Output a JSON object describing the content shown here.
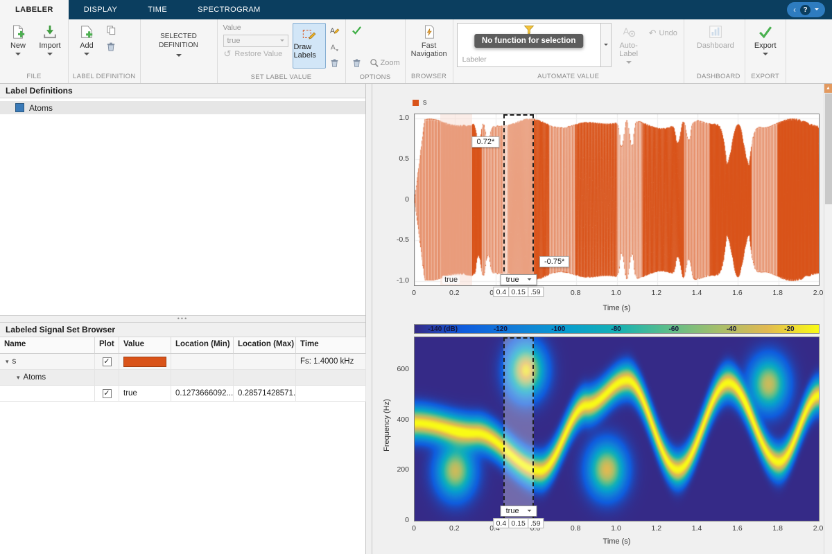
{
  "colors": {
    "accent_orange": "#D95319",
    "toolstrip_blue": "#0B3E5F",
    "help_pill_blue": "#2E7CC0",
    "selected_button_bg": "#D2E6F7",
    "colormap": "parula"
  },
  "tabbar": {
    "tabs": [
      {
        "label": "LABELER",
        "active": true
      },
      {
        "label": "DISPLAY",
        "active": false
      },
      {
        "label": "TIME",
        "active": false
      },
      {
        "label": "SPECTROGRAM",
        "active": false
      }
    ]
  },
  "ribbon": {
    "file": {
      "section": "FILE",
      "new": "New",
      "import": "Import"
    },
    "label_definition": {
      "section": "LABEL DEFINITION",
      "add": "Add"
    },
    "selected_definition": {
      "button": "SELECTED DEFINITION"
    },
    "set_label_value": {
      "section": "SET LABEL VALUE",
      "value_caption": "Value",
      "value": "true",
      "restore": "Restore Value",
      "draw_labels": "Draw Labels"
    },
    "options": {
      "section": "OPTIONS",
      "zoom": "Zoom"
    },
    "browser": {
      "section": "BROWSER",
      "fast_navigation": "Fast Navigation"
    },
    "automate": {
      "section": "AUTOMATE VALUE",
      "tooltip": "No function for selection",
      "gallery_caption": "Labeler",
      "auto_label": "Auto-Label",
      "undo": "Undo"
    },
    "dashboard": {
      "section": "DASHBOARD",
      "button": "Dashboard"
    },
    "export": {
      "section": "EXPORT",
      "button": "Export"
    }
  },
  "panels": {
    "label_definitions": {
      "title": "Label Definitions",
      "items": [
        {
          "name": "Atoms",
          "selected": true
        }
      ]
    },
    "signal_browser": {
      "title": "Labeled Signal Set Browser",
      "columns": [
        "Name",
        "Plot",
        "Value",
        "Location (Min)",
        "Location (Max)",
        "Time"
      ],
      "rows": [
        {
          "name": "s",
          "expanded": true,
          "plot_checked": true,
          "value": "",
          "has_swatch": true,
          "loc_min": "",
          "loc_max": "",
          "time": "Fs: 1.4000 kHz"
        },
        {
          "name": "Atoms",
          "expanded": true,
          "plot_checked": false,
          "value": "",
          "has_swatch": false,
          "loc_min": "",
          "loc_max": "",
          "time": ""
        },
        {
          "name": "",
          "expanded": false,
          "plot_checked": true,
          "value": "true",
          "has_swatch": false,
          "loc_min": "0.1273666092...",
          "loc_max": "0.28571428571...",
          "time": ""
        }
      ]
    }
  },
  "chart_data": [
    {
      "type": "line",
      "legend_label": "s",
      "series_color": "#D95319",
      "xlabel": "Time (s)",
      "ylabel": "",
      "xlim": [
        0,
        2
      ],
      "ylim": [
        -1.05,
        1.05
      ],
      "xticks": [
        0,
        0.2,
        0.4,
        0.6,
        0.8,
        1.0,
        1.2,
        1.4,
        1.6,
        1.8,
        2.0
      ],
      "yticks": [
        1.0,
        0.5,
        0,
        -0.5,
        -1.0
      ],
      "description": "Dense oscillatory signal s(t) filling amplitude range -1..1 over 0..2 s, with envelope pinches near t=0.34, 1.05, 1.33 and 1.6 s",
      "labeled_region": {
        "start": 0.1273666092,
        "end": 0.28571428571,
        "label": "true"
      },
      "selection": {
        "start": 0.44,
        "end": 0.59,
        "dropdown": "true",
        "value_boxes": [
          "0.4",
          "0.15",
          ".59"
        ],
        "tooltip_high": "0.72*",
        "tooltip_low": "-0.75*"
      }
    },
    {
      "type": "heatmap",
      "xlabel": "Time (s)",
      "ylabel": "Frequency (Hz)",
      "xlim": [
        0,
        2
      ],
      "ylim": [
        0,
        730
      ],
      "xticks": [
        0,
        0.2,
        0.4,
        0.6,
        0.8,
        1.0,
        1.2,
        1.4,
        1.6,
        1.8,
        2.0
      ],
      "yticks": [
        0,
        200,
        400,
        600
      ],
      "colorbar": {
        "range_db": [
          -150,
          -10
        ],
        "ticks": [
          {
            "value": -140,
            "label": "-140 (dB)"
          },
          {
            "value": -120,
            "label": "-120"
          },
          {
            "value": -100,
            "label": "-100"
          },
          {
            "value": -80,
            "label": "-80"
          },
          {
            "value": -60,
            "label": "-60"
          },
          {
            "value": -40,
            "label": "-40"
          },
          {
            "value": -20,
            "label": "-20"
          }
        ]
      },
      "ridge_track_hz": [
        [
          0,
          390
        ],
        [
          0.3,
          350
        ],
        [
          0.62,
          200
        ],
        [
          0.85,
          460
        ],
        [
          1.05,
          560
        ],
        [
          1.3,
          205
        ],
        [
          1.55,
          550
        ],
        [
          1.8,
          235
        ],
        [
          2.0,
          500
        ]
      ],
      "blobs": [
        {
          "t": 0.2,
          "f": 200,
          "a": 0.8
        },
        {
          "t": 0.55,
          "f": 600,
          "a": 0.95
        },
        {
          "t": 0.95,
          "f": 205,
          "a": 0.85
        },
        {
          "t": 1.75,
          "f": 545,
          "a": 0.8
        }
      ],
      "selection": {
        "start": 0.44,
        "end": 0.59,
        "dropdown": "true",
        "value_boxes": [
          "0.4",
          "0.15",
          ".59"
        ]
      }
    }
  ]
}
